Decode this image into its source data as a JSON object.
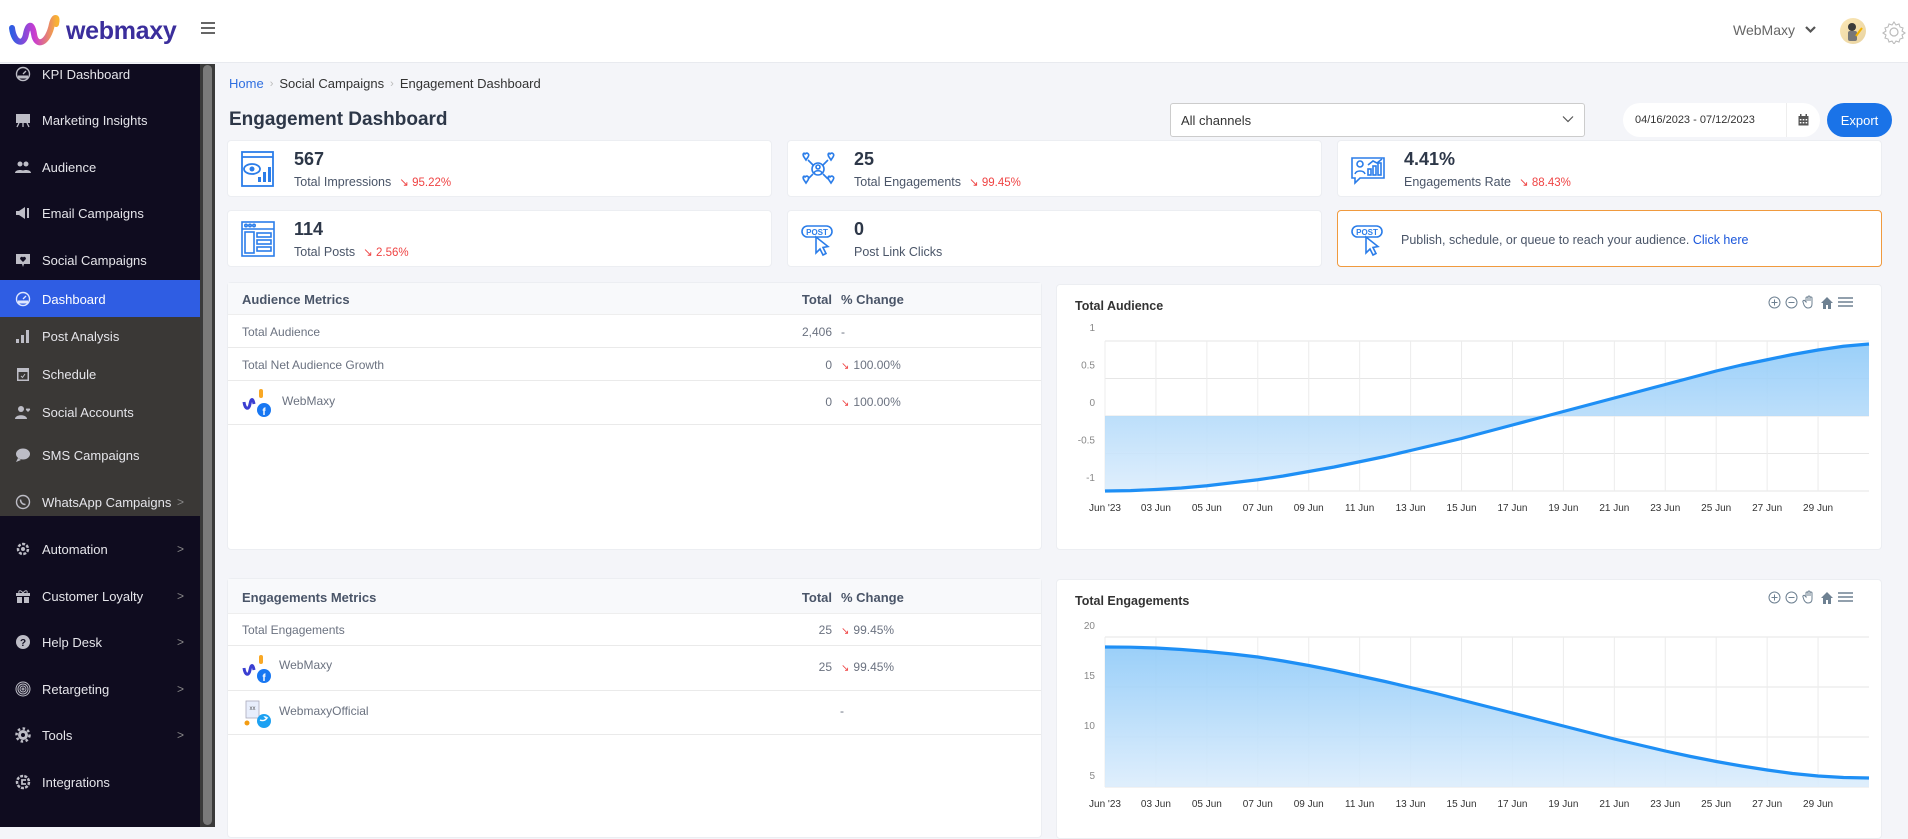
{
  "brand": {
    "name": "webmaxy"
  },
  "header": {
    "account_name": "WebMaxy"
  },
  "sidebar": {
    "items": [
      {
        "label": "KPI Dashboard",
        "icon": "dashboard-gauge-icon"
      },
      {
        "label": "Marketing Insights",
        "icon": "presentation-board-icon"
      },
      {
        "label": "Audience",
        "icon": "users-icon"
      },
      {
        "label": "Email Campaigns",
        "icon": "megaphone-icon"
      },
      {
        "label": "Social Campaigns",
        "icon": "social-chat-icon"
      },
      {
        "label": "Dashboard",
        "icon": "dashboard-gauge-icon",
        "active": true
      },
      {
        "label": "Post Analysis",
        "icon": "bar-chart-icon"
      },
      {
        "label": "Schedule",
        "icon": "calendar-icon"
      },
      {
        "label": "Social Accounts",
        "icon": "user-heart-icon"
      },
      {
        "label": "SMS Campaigns",
        "icon": "sms-bubble-icon"
      },
      {
        "label": "WhatsApp Campaigns",
        "icon": "whatsapp-icon",
        "has_children": true
      },
      {
        "label": "Automation",
        "icon": "automation-gear-icon",
        "has_children": true
      },
      {
        "label": "Customer Loyalty",
        "icon": "gift-icon",
        "has_children": true
      },
      {
        "label": "Help Desk",
        "icon": "help-circle-icon",
        "has_children": true
      },
      {
        "label": "Retargeting",
        "icon": "target-icon",
        "has_children": true
      },
      {
        "label": "Tools",
        "icon": "cog-icon",
        "has_children": true
      },
      {
        "label": "Integrations",
        "icon": "integrations-icon"
      }
    ]
  },
  "breadcrumb": [
    "Home",
    "Social Campaigns",
    "Engagement Dashboard"
  ],
  "page_title": "Engagement Dashboard",
  "filters": {
    "channel": "All channels",
    "date_range": "04/16/2023 - 07/12/2023",
    "export_label": "Export"
  },
  "stats": [
    {
      "value": "567",
      "label": "Total Impressions",
      "change": "95.22%",
      "trend": "down",
      "icon": "impressions-icon"
    },
    {
      "value": "25",
      "label": "Total Engagements",
      "change": "99.45%",
      "trend": "down",
      "icon": "engagement-network-icon"
    },
    {
      "value": "4.41%",
      "label": "Engagements Rate",
      "change": "88.43%",
      "trend": "down",
      "icon": "engagement-rate-icon"
    },
    {
      "value": "114",
      "label": "Total Posts",
      "change": "2.56%",
      "trend": "down",
      "icon": "posts-layout-icon"
    },
    {
      "value": "0",
      "label": "Post Link Clicks",
      "change": "",
      "icon": "post-click-icon"
    }
  ],
  "promo": {
    "text": "Publish, schedule, or queue to reach your audience.",
    "link": "Click here"
  },
  "audience_metrics": {
    "title": "Audience Metrics",
    "col_total": "Total",
    "col_change": "% Change",
    "rows": [
      {
        "name": "Total Audience",
        "total": "2,406",
        "change": "-",
        "trend": ""
      },
      {
        "name": "Total Net Audience Growth",
        "total": "0",
        "change": "100.00%",
        "trend": "down"
      },
      {
        "name": "WebMaxy",
        "total": "0",
        "change": "100.00%",
        "trend": "down",
        "network": "facebook"
      }
    ]
  },
  "engagement_metrics": {
    "title": "Engagements Metrics",
    "col_total": "Total",
    "col_change": "% Change",
    "rows": [
      {
        "name": "Total Engagements",
        "total": "25",
        "change": "99.45%",
        "trend": "down"
      },
      {
        "name": "WebMaxy",
        "total": "25",
        "change": "99.45%",
        "trend": "down",
        "network": "facebook"
      },
      {
        "name": "WebmaxyOfficial",
        "total": "",
        "change": "-",
        "trend": "",
        "network": "twitter"
      }
    ]
  },
  "chart_data": [
    {
      "type": "area",
      "title": "Total Audience",
      "x_ticks": [
        "Jun '23",
        "03 Jun",
        "05 Jun",
        "07 Jun",
        "09 Jun",
        "11 Jun",
        "13 Jun",
        "15 Jun",
        "17 Jun",
        "19 Jun",
        "21 Jun",
        "23 Jun",
        "25 Jun",
        "27 Jun",
        "29 Jun"
      ],
      "y_ticks": [
        "1",
        "0.5",
        "0",
        "-0.5",
        "-1"
      ],
      "ylim": [
        -1,
        1
      ],
      "baseline": 0,
      "series": [
        {
          "name": "Total Audience",
          "x": [
            1,
            2,
            3,
            4,
            5,
            6,
            7,
            8,
            9,
            10,
            11,
            12,
            13,
            14,
            15,
            16,
            17,
            18,
            19,
            20,
            21,
            22,
            23,
            24,
            25,
            26,
            27,
            28,
            29,
            30,
            31
          ],
          "values": [
            -1,
            -0.995,
            -0.98,
            -0.96,
            -0.93,
            -0.89,
            -0.85,
            -0.8,
            -0.74,
            -0.68,
            -0.61,
            -0.54,
            -0.46,
            -0.38,
            -0.3,
            -0.21,
            -0.12,
            -0.03,
            0.06,
            0.15,
            0.24,
            0.33,
            0.42,
            0.51,
            0.6,
            0.68,
            0.75,
            0.82,
            0.88,
            0.93,
            0.96
          ]
        }
      ],
      "color": "#1e8ff5",
      "grid": true
    },
    {
      "type": "area",
      "title": "Total Engagements",
      "x_ticks": [
        "Jun '23",
        "03 Jun",
        "05 Jun",
        "07 Jun",
        "09 Jun",
        "11 Jun",
        "13 Jun",
        "15 Jun",
        "17 Jun",
        "19 Jun",
        "21 Jun",
        "23 Jun",
        "25 Jun",
        "27 Jun",
        "29 Jun"
      ],
      "y_ticks": [
        "20",
        "15",
        "10",
        "5"
      ],
      "ylim": [
        5,
        20
      ],
      "series": [
        {
          "name": "Total Engagements",
          "x": [
            1,
            2,
            3,
            4,
            5,
            6,
            7,
            8,
            9,
            10,
            11,
            12,
            13,
            14,
            15,
            16,
            17,
            18,
            19,
            20,
            21,
            22,
            23,
            24,
            25,
            26,
            27,
            28,
            29,
            30,
            31
          ],
          "values": [
            19,
            18.98,
            18.9,
            18.75,
            18.55,
            18.3,
            18,
            17.6,
            17.15,
            16.65,
            16.1,
            15.55,
            14.95,
            14.35,
            13.7,
            13.05,
            12.4,
            11.75,
            11.1,
            10.45,
            9.8,
            9.2,
            8.6,
            8.05,
            7.55,
            7.1,
            6.7,
            6.35,
            6.1,
            5.95,
            5.9
          ]
        }
      ],
      "color": "#1e8ff5",
      "grid": true
    }
  ]
}
